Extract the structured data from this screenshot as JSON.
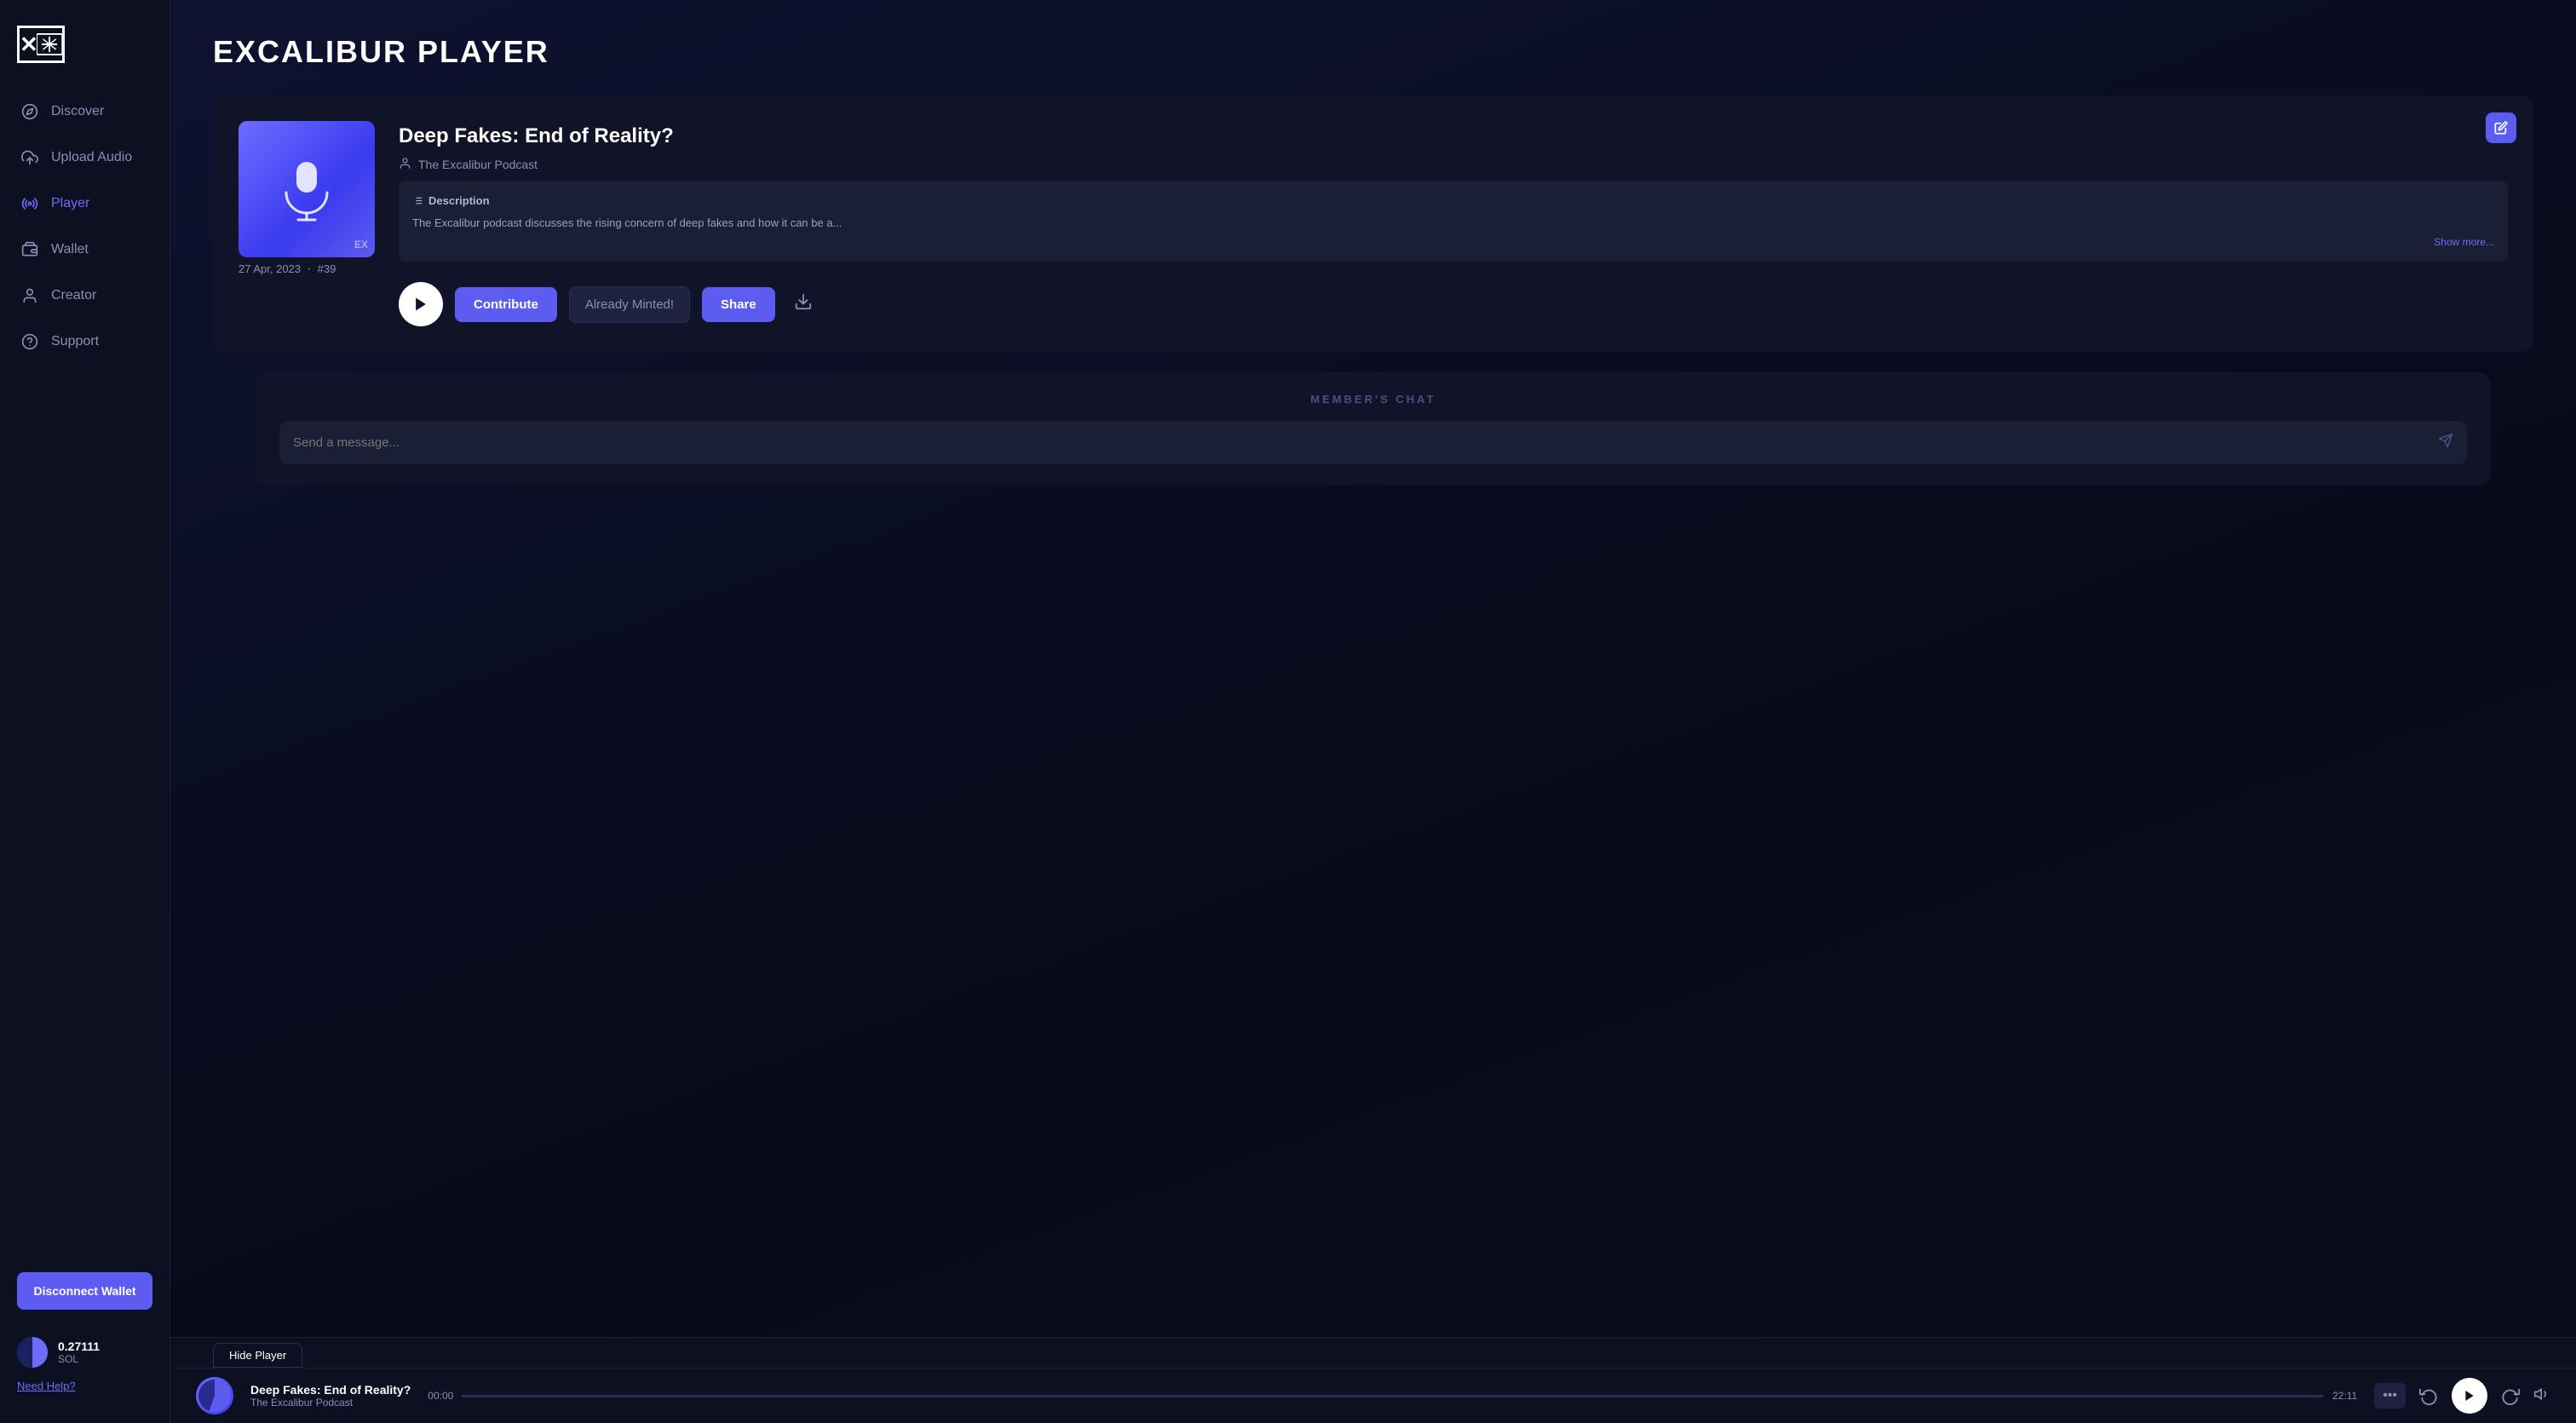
{
  "app": {
    "title": "EXCALIBUR PLAYER",
    "logo_text": "EX"
  },
  "sidebar": {
    "nav_items": [
      {
        "id": "discover",
        "label": "Discover",
        "icon": "compass",
        "active": false
      },
      {
        "id": "upload-audio",
        "label": "Upload Audio",
        "icon": "upload",
        "active": false
      },
      {
        "id": "player",
        "label": "Player",
        "icon": "radio",
        "active": true
      },
      {
        "id": "wallet",
        "label": "Wallet",
        "icon": "wallet",
        "active": false
      },
      {
        "id": "creator",
        "label": "Creator",
        "icon": "user",
        "active": false
      },
      {
        "id": "support",
        "label": "Support",
        "icon": "help-circle",
        "active": false
      }
    ],
    "disconnect_wallet_label": "Disconnect Wallet",
    "wallet": {
      "amount": "0.27111",
      "unit": "SOL"
    },
    "need_help_label": "Need Help?"
  },
  "player": {
    "track_title": "Deep Fakes: End of Reality?",
    "podcast_name": "The Excalibur Podcast",
    "description_label": "Description",
    "description_text": "The Excalibur podcast discusses the rising concern of deep fakes and how it can be a...",
    "show_more_label": "Show more...",
    "date": "27 Apr, 2023",
    "episode_number": "#39",
    "buttons": {
      "contribute": "Contribute",
      "already_minted": "Already Minted!",
      "share": "Share"
    }
  },
  "chat": {
    "header": "MEMBER'S CHAT",
    "placeholder": "Send a message..."
  },
  "bottom_player": {
    "hide_player_label": "Hide Player",
    "track_title": "Deep Fakes: End of Reality?",
    "podcast_name": "The Excalibur Podcast",
    "time_current": "00:00",
    "time_total": "22:11"
  }
}
